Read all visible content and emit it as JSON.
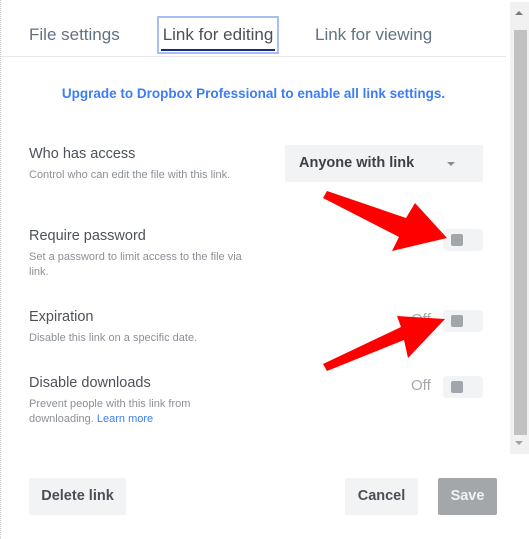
{
  "tabs": [
    {
      "label": "File settings",
      "active": false
    },
    {
      "label": "Link for editing",
      "active": true
    },
    {
      "label": "Link for viewing",
      "active": false
    }
  ],
  "upgrade_banner": "Upgrade to Dropbox Professional to enable all link settings.",
  "settings": {
    "who_has_access": {
      "title": "Who has access",
      "description": "Control who can edit the file with this link.",
      "selected": "Anyone with link"
    },
    "require_password": {
      "title": "Require password",
      "description": "Set a password to limit access to the file via link.",
      "state": "Off"
    },
    "expiration": {
      "title": "Expiration",
      "description": "Disable this link on a specific date.",
      "state": "Off"
    },
    "disable_downloads": {
      "title": "Disable downloads",
      "description": "Prevent people with this link from downloading.",
      "learn_more": "Learn more",
      "state": "Off"
    }
  },
  "footer": {
    "delete_label": "Delete link",
    "cancel_label": "Cancel",
    "save_label": "Save"
  },
  "colors": {
    "accent": "#3d7df5",
    "annotation_arrow": "#ff0000",
    "save_disabled": "#a4a7aa"
  }
}
